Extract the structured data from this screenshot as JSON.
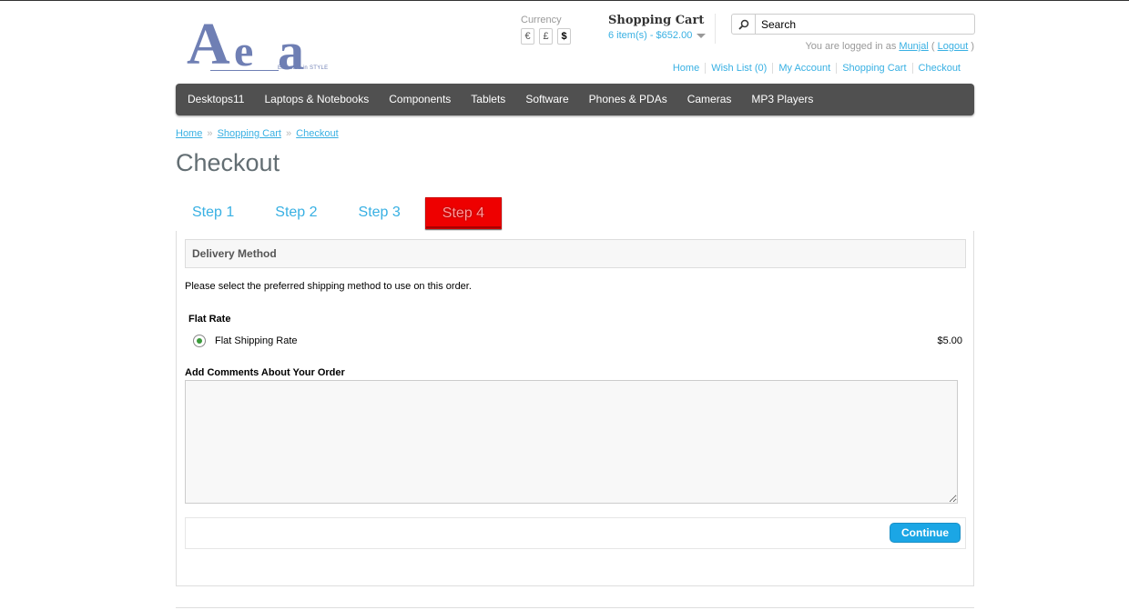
{
  "logo": {
    "letters": [
      "A",
      "e",
      "a"
    ],
    "tagline": "Elevated in STYLE"
  },
  "currency": {
    "label": "Currency",
    "options": [
      "€",
      "£",
      "$"
    ],
    "selected": "$"
  },
  "cart": {
    "title": "Shopping Cart",
    "summary": "6 item(s) - $652.00"
  },
  "search": {
    "placeholder": "Search",
    "value": "Search"
  },
  "welcome": {
    "prefix": "You are logged in as",
    "user": "Munjal",
    "open": "(",
    "logout": "Logout",
    "close": ")"
  },
  "top_links": [
    "Home",
    "Wish List (0)",
    "My Account",
    "Shopping Cart",
    "Checkout"
  ],
  "menu": [
    "Desktops11",
    "Laptops & Notebooks",
    "Components",
    "Tablets",
    "Software",
    "Phones & PDAs",
    "Cameras",
    "MP3 Players"
  ],
  "breadcrumb": {
    "items": [
      "Home",
      "Shopping Cart",
      "Checkout"
    ],
    "separator": "»"
  },
  "page_title": "Checkout",
  "steps": [
    "Step 1",
    "Step 2",
    "Step 3",
    "Step 4"
  ],
  "active_step": 4,
  "delivery": {
    "heading": "Delivery Method",
    "intro": "Please select the preferred shipping method to use on this order.",
    "method_title": "Flat Rate",
    "option_name": "Flat Shipping Rate",
    "option_price": "$5.00",
    "comments_label": "Add Comments About Your Order",
    "comments_value": "",
    "continue_label": "Continue"
  },
  "colors": {
    "accent": "#38b0e3",
    "menu_bg": "#505050",
    "active_step": "#ee0000",
    "button": "#1ba6e5"
  }
}
